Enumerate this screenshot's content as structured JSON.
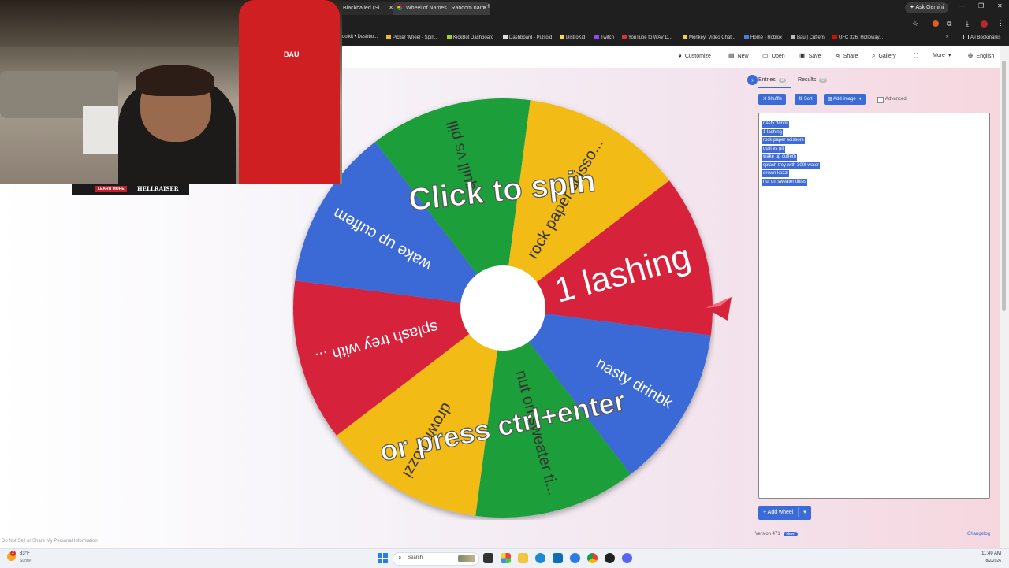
{
  "browser": {
    "tabs": [
      {
        "title": "Blackballed (Sl..."
      },
      {
        "title": "Wheel of Names | Random nam..."
      }
    ],
    "new_tab": "+",
    "ask_gemini": "Ask Gemini",
    "bookmarks": [
      "oolkit • Dashbo...",
      "Picker Wheel - Spin...",
      "KickBot Dashboard",
      "Dashboard - Pulsoid",
      "DistroKid",
      "Twitch",
      "YouTube to WAV D...",
      "Monkey: Video Chat...",
      "Home - Roblox",
      "Bau | Cuffem",
      "UFC 326: Holloway..."
    ],
    "all_bookmarks": "All Bookmarks"
  },
  "toolbar": {
    "customize": "Customize",
    "new": "New",
    "open": "Open",
    "save": "Save",
    "share": "Share",
    "gallery": "Gallery",
    "more": "More",
    "language": "English"
  },
  "wheel": {
    "overlay_top": "Click to spin",
    "overlay_bottom": "or press ctrl+enter",
    "slices": [
      {
        "label": "1 lashing",
        "color": "#d6233a"
      },
      {
        "label": "nasty drinbk",
        "color": "#3b6bd6"
      },
      {
        "label": "nut on sweater ti...",
        "color": "#1e9e3b"
      },
      {
        "label": "drown kozzi",
        "color": "#f2bb17"
      },
      {
        "label": "splash trey with ...",
        "color": "#d6233a"
      },
      {
        "label": "wake up cuffem",
        "color": "#3b6bd6"
      },
      {
        "label": "quill vs pill",
        "color": "#1e9e3b"
      },
      {
        "label": "rock paper scisso...",
        "color": "#f2bb17"
      }
    ]
  },
  "sidebar": {
    "tab_entries": "Entries",
    "entries_count": "8",
    "tab_results": "Results",
    "results_count": "0",
    "shuffle": "Shuffle",
    "sort": "Sort",
    "add_image": "Add image",
    "advanced": "Advanced",
    "entries": [
      "nasty drinbk",
      "1 lashing",
      "rock paper scissors",
      "quill vs pill",
      "wake up cuffem",
      "splash trey with 300f water",
      "drown kozzi",
      "nut on sweater titties"
    ],
    "add_wheel": "Add wheel",
    "version": "Version 471",
    "new_badge": "New!",
    "changelog": "Changelog"
  },
  "footer": {
    "do_not_sell": "Do Not Sell or Share My Personal Information"
  },
  "stream": {
    "banner_left": "LEARN MORE",
    "banner_right": "HELLRAISER",
    "shirt_text": "BAU"
  },
  "taskbar": {
    "weather_temp": "83°F",
    "weather_desc": "Sunny",
    "weather_badge": "2",
    "search": "Search",
    "time": "11:49 AM",
    "date": "8/2/2026"
  },
  "colors": {
    "accent": "#3b6bd6",
    "red": "#d6233a",
    "green": "#1e9e3b",
    "yellow": "#f2bb17",
    "blue": "#3b6bd6"
  }
}
